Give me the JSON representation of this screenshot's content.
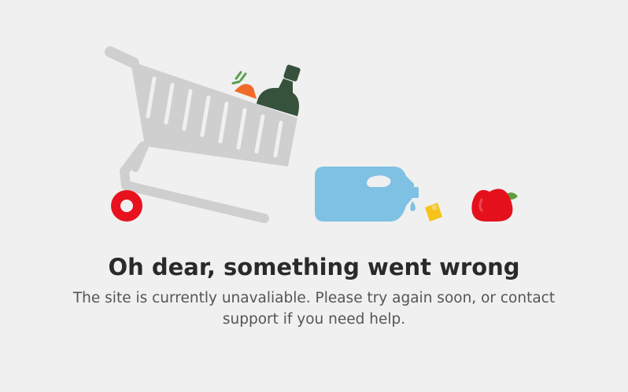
{
  "error": {
    "title": "Oh dear, something went wrong",
    "message": "The site is currently unavaliable. Please try again soon, or contact support if you need help."
  },
  "illustration": {
    "items": [
      "shopping-cart-icon",
      "carrot-icon",
      "wine-bottle-icon",
      "detergent-jug-icon",
      "water-drop-icon",
      "bottle-cap-icon",
      "apple-icon"
    ],
    "colors": {
      "cart": "#cfcfcf",
      "wheel": "#e8121f",
      "carrot": "#f06b2a",
      "carrot_leaves": "#5a9e4e",
      "bottle": "#36523c",
      "jug": "#7ec1e3",
      "cap": "#f7c21a",
      "apple": "#e4111d",
      "apple_leaf": "#5e9e3e",
      "background": "#f0f0f0"
    }
  }
}
